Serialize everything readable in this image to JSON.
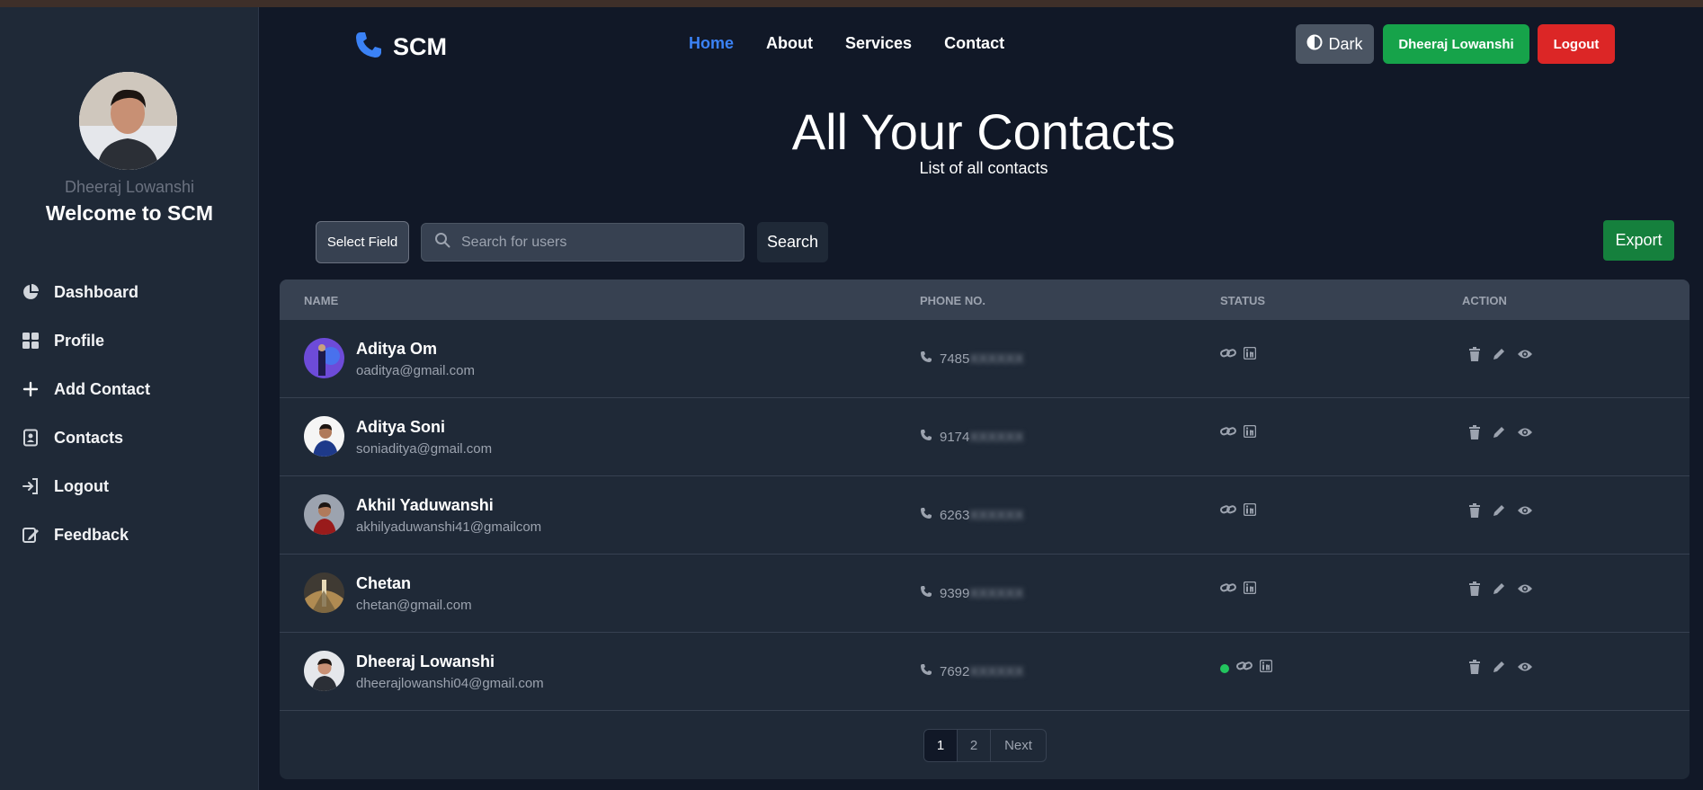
{
  "app": {
    "brand": "SCM"
  },
  "colors": {
    "accent": "#3b82f6",
    "success": "#16a34a",
    "danger": "#dc2626",
    "online": "#22c55e"
  },
  "sidebar": {
    "username": "Dheeraj Lowanshi",
    "welcome": "Welcome to SCM",
    "items": [
      {
        "label": "Dashboard",
        "icon": "pie-chart-icon"
      },
      {
        "label": "Profile",
        "icon": "grid-icon"
      },
      {
        "label": "Add Contact",
        "icon": "plus-icon"
      },
      {
        "label": "Contacts",
        "icon": "address-book-icon"
      },
      {
        "label": "Logout",
        "icon": "logout-icon"
      },
      {
        "label": "Feedback",
        "icon": "feedback-icon"
      }
    ]
  },
  "navbar": {
    "links": [
      {
        "label": "Home",
        "active": true
      },
      {
        "label": "About",
        "active": false
      },
      {
        "label": "Services",
        "active": false
      },
      {
        "label": "Contact",
        "active": false
      }
    ],
    "theme_label": "Dark",
    "user_label": "Dheeraj Lowanshi",
    "logout_label": "Logout"
  },
  "main": {
    "title": "All Your Contacts",
    "subtitle": "List of all contacts"
  },
  "search": {
    "field_label": "Select Field",
    "placeholder": "Search for users",
    "value": "",
    "button_label": "Search",
    "export_label": "Export"
  },
  "table": {
    "headers": [
      "NAME",
      "PHONE NO.",
      "STATUS",
      "ACTION"
    ],
    "rows": [
      {
        "name": "Aditya Om",
        "email": "oaditya@gmail.com",
        "phone_visible": "7485",
        "phone_hidden": "XXXXXX",
        "favorite": false
      },
      {
        "name": "Aditya Soni",
        "email": "soniaditya@gmail.com",
        "phone_visible": "9174",
        "phone_hidden": "XXXXXX",
        "favorite": false
      },
      {
        "name": "Akhil Yaduwanshi",
        "email": "akhilyaduwanshi41@gmailcom",
        "phone_visible": "6263",
        "phone_hidden": "XXXXXX",
        "favorite": false
      },
      {
        "name": "Chetan",
        "email": "chetan@gmail.com",
        "phone_visible": "9399",
        "phone_hidden": "XXXXXX",
        "favorite": false
      },
      {
        "name": "Dheeraj Lowanshi",
        "email": "dheerajlowanshi04@gmail.com",
        "phone_visible": "7692",
        "phone_hidden": "XXXXXX",
        "favorite": true
      }
    ]
  },
  "pagination": {
    "pages": [
      "1",
      "2"
    ],
    "current": "1",
    "next_label": "Next"
  }
}
